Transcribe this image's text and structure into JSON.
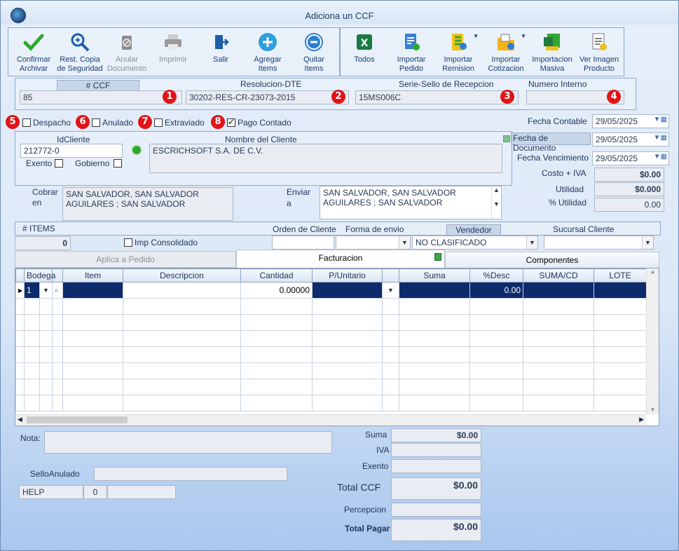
{
  "window": {
    "title": "Adiciona un CCF"
  },
  "toolbar": {
    "left": [
      {
        "line1": "Confirmar",
        "line2": "Archivar",
        "icon": "checkmark-icon"
      },
      {
        "line1": "Rest. Copia",
        "line2": "de Seguridad",
        "icon": "zoom-restore-icon"
      },
      {
        "line1": "Anular",
        "line2": "Documento",
        "icon": "trash-icon"
      },
      {
        "line1": "Imprimir",
        "line2": "",
        "icon": "printer-icon"
      },
      {
        "line1": "Salir",
        "line2": "",
        "icon": "exit-door-icon"
      },
      {
        "line1": "Agregar",
        "line2": "Items",
        "icon": "plus-circle-icon"
      },
      {
        "line1": "Quitar",
        "line2": "Items",
        "icon": "minus-circle-icon"
      }
    ],
    "right": [
      {
        "line1": "Todos",
        "line2": "",
        "icon": "excel-icon"
      },
      {
        "line1": "Importar",
        "line2": "Pedido",
        "icon": "import-order-icon"
      },
      {
        "line1": "Importar",
        "line2": "Remision",
        "icon": "import-remission-icon"
      },
      {
        "line1": "Importar",
        "line2": "Cotizacion",
        "icon": "import-quote-icon"
      },
      {
        "line1": "Importacion",
        "line2": "Masiva",
        "icon": "excel-bulk-icon"
      },
      {
        "line1": "Ver Imagen",
        "line2": "Producto",
        "icon": "product-image-icon"
      }
    ]
  },
  "header": {
    "ccf_label": "# CCF",
    "ccf_value": "85",
    "resolucion_label": "Resolucion-DTE",
    "resolucion_value": "30202-RES-CR-23073-2015",
    "serie_label": "Serie-Sello de Recepcion",
    "serie_value": "15MS006C",
    "numero_interno_label": "Numero Interno",
    "numero_interno_value": ""
  },
  "badges": [
    "1",
    "2",
    "3",
    "4",
    "5",
    "6",
    "7",
    "8"
  ],
  "checks": {
    "despacho": "Despacho",
    "anulado": "Anulado",
    "extraviado": "Extraviado",
    "pago_contado": "Pago Contado"
  },
  "dates": {
    "contable_label": "Fecha Contable",
    "contable": "29/05/2025",
    "documento_label": "Fecha de Documento",
    "documento": "29/05/2025",
    "vencimiento_label": "Fecha Vencimiento",
    "vencimiento": "29/05/2025"
  },
  "cliente": {
    "id_label": "IdCliente",
    "id_value": "212772-0",
    "nombre_label": "Nombre del Cliente",
    "nombre_value": "ESCRICHSOFT S.A. DE C.V.",
    "exento": "Exento",
    "gobierno": "Gobierno"
  },
  "costos": {
    "costo_iva_label": "Costo + IVA",
    "costo_iva": "$0.00",
    "utilidad_label": "Utilidad",
    "utilidad": "$0.000",
    "pct_utilidad_label": "% Utilidad",
    "pct_utilidad": "0.00"
  },
  "direcciones": {
    "cobrar_label1": "Cobrar",
    "cobrar_label2": "en",
    "cobrar_line1": "SAN SALVADOR, SAN SALVADOR",
    "cobrar_line2": "AGUILARES ; SAN SALVADOR",
    "enviar_label1": "Enviar",
    "enviar_label2": "a",
    "enviar_line1": "SAN SALVADOR, SAN SALVADOR",
    "enviar_line2": "AGUILARES ; SAN SALVADOR"
  },
  "items_bar": {
    "items_label": "# ITEMS",
    "items_count": "0",
    "imp_consolidado": "Imp Consolidado",
    "orden_label": "Orden de Cliente",
    "orden_value": "",
    "forma_label": "Forma de envio",
    "forma_value": "",
    "vendedor_label": "Vendedor",
    "vendedor_value": "NO CLASIFICADO",
    "sucursal_label": "Sucursal Cliente",
    "sucursal_value": ""
  },
  "tabs": [
    "Aplica a Pedido",
    "Facturacion",
    "Componentes"
  ],
  "grid": {
    "columns": [
      "Bodega",
      "",
      "Item",
      "Descripcion",
      "Cantidad",
      "P/Unitario",
      "",
      "Suma",
      "%Desc",
      "SUMA/CD",
      "LOTE"
    ],
    "row1": {
      "bodega": "1",
      "cantidad": "0.00000",
      "desc": "0.00"
    }
  },
  "footer": {
    "nota_label": "Nota:",
    "sello_label": "SelloAnulado",
    "help": "HELP",
    "help_num": "0",
    "suma_label": "Suma",
    "suma": "$0.00",
    "iva_label": "IVA",
    "iva": "",
    "exento_label": "Exento",
    "exento": "",
    "total_ccf_label": "Total CCF",
    "total_ccf": "$0.00",
    "percepcion_label": "Percepcion",
    "percepcion": "",
    "total_pagar_label": "Total Pagar",
    "total_pagar": "$0.00"
  },
  "colors": {
    "badge": "#e01418",
    "selected_row": "#0d2a6c",
    "accent": "#1b3d73"
  }
}
